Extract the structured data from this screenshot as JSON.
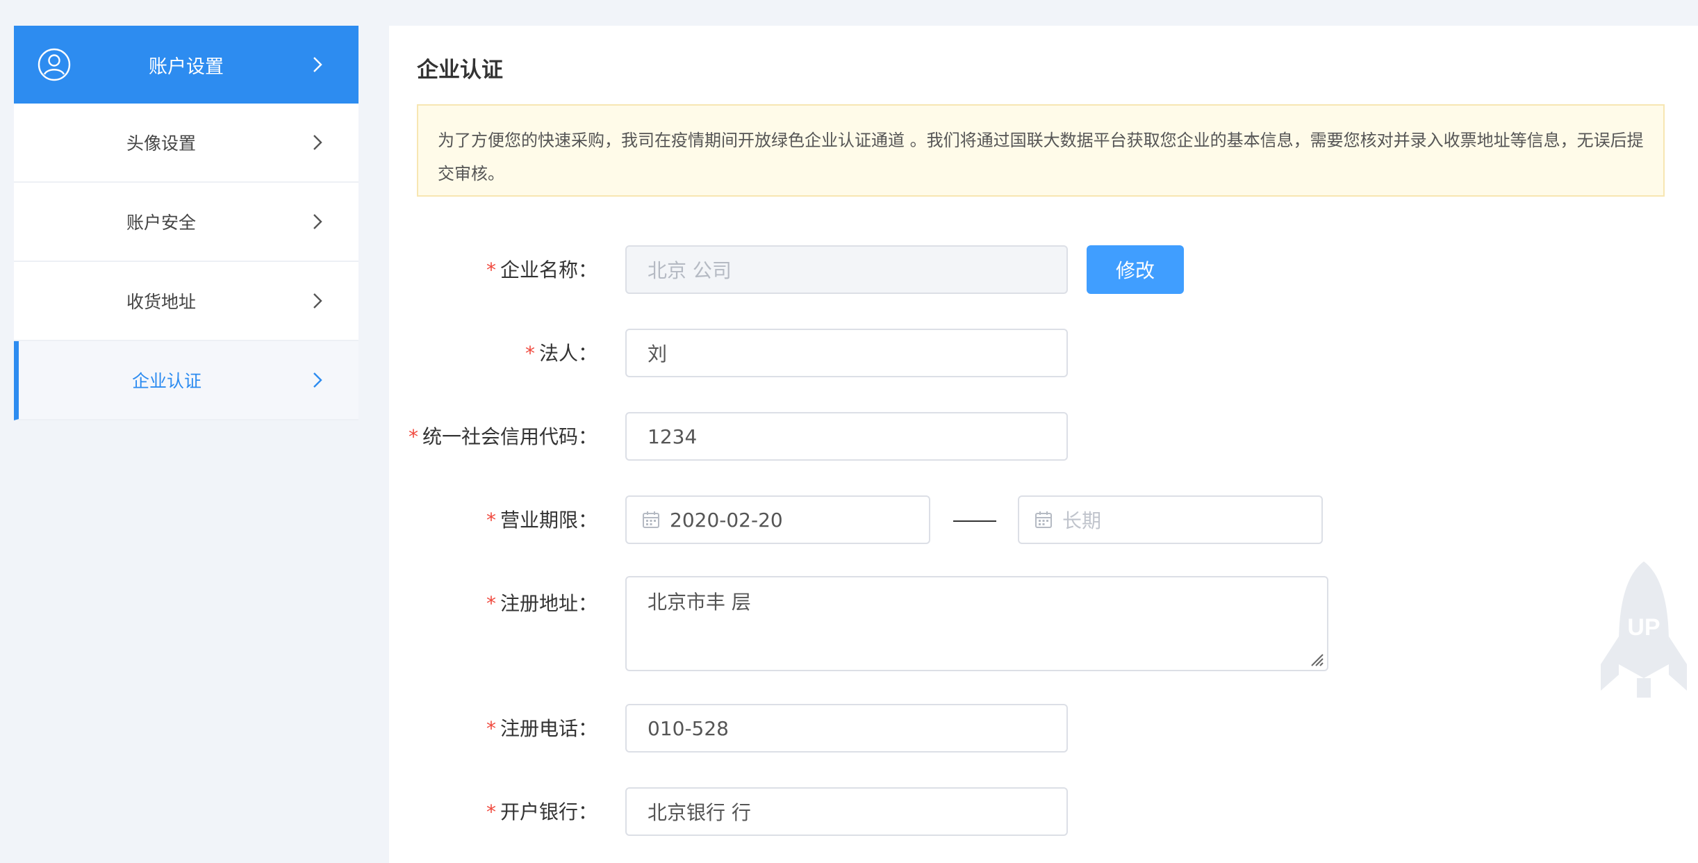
{
  "sidebar": {
    "header_label": "账户设置",
    "items": [
      {
        "label": "头像设置"
      },
      {
        "label": "账户安全"
      },
      {
        "label": "收货地址"
      },
      {
        "label": "企业认证"
      }
    ]
  },
  "main": {
    "title": "企业认证",
    "notice": "为了方便您的快速采购，我司在疫情期间开放绿色企业认证通道 。我们将通过国联大数据平台获取您企业的基本信息，需要您核对并录入收票地址等信息，无误后提交审核。"
  },
  "form": {
    "required_mark": "*",
    "company_name": {
      "label": "企业名称：",
      "value": "北京 公司"
    },
    "edit_button": "修改",
    "legal_person": {
      "label": "法人：",
      "value": "刘"
    },
    "credit_code": {
      "label": "统一社会信用代码：",
      "value": "1234"
    },
    "business_term": {
      "label": "营业期限：",
      "start": "2020-02-20",
      "end_placeholder": "长期"
    },
    "reg_address": {
      "label": "注册地址：",
      "value": "北京市丰 层"
    },
    "reg_phone": {
      "label": "注册电话：",
      "value": "010-528"
    },
    "bank": {
      "label": "开户银行：",
      "value": "北京银行 行"
    }
  },
  "back_to_top": {
    "label": "UP"
  },
  "colors": {
    "primary": "#2d8cf0",
    "button": "#409eff",
    "required": "#f04a3f",
    "notice_bg": "#fffbe9"
  }
}
